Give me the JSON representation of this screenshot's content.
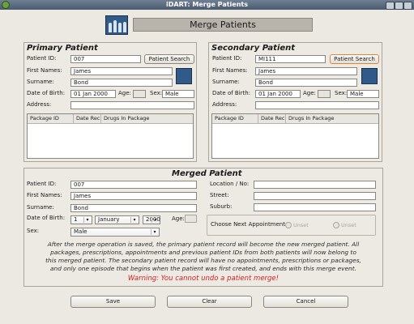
{
  "window": {
    "title": "iDART: Merge Patients"
  },
  "header": {
    "title": "Merge Patients"
  },
  "primary": {
    "title": "Primary Patient",
    "patient_id_label": "Patient ID:",
    "patient_id": "007",
    "search_button": "Patient Search",
    "first_names_label": "First Names:",
    "first_names": "James",
    "surname_label": "Surname:",
    "surname": "Bond",
    "dob_label": "Date of Birth:",
    "dob": "01 Jan 2000",
    "age_label": "Age:",
    "age": "",
    "sex_label": "Sex:",
    "sex": "Male",
    "address_label": "Address:",
    "address": "",
    "table_headers": [
      "Package ID",
      "Date Rec",
      "Drugs In Package"
    ]
  },
  "secondary": {
    "title": "Secondary Patient",
    "patient_id_label": "Patient ID:",
    "patient_id": "MI111",
    "search_button": "Patient Search",
    "first_names_label": "First Names:",
    "first_names": "James",
    "surname_label": "Surname:",
    "surname": "Bond",
    "dob_label": "Date of Birth:",
    "dob": "01 Jan 2000",
    "age_label": "Age:",
    "age": "",
    "sex_label": "Sex:",
    "sex": "Male",
    "address_label": "Address:",
    "address": "",
    "table_headers": [
      "Package ID",
      "Date Rec",
      "Drugs In Package"
    ]
  },
  "merged": {
    "title": "Merged Patient",
    "patient_id_label": "Patient ID:",
    "patient_id": "007",
    "first_names_label": "First Names:",
    "first_names": "James",
    "surname_label": "Surname:",
    "surname": "Bond",
    "dob_label": "Date of Birth:",
    "dob_day": "1",
    "dob_month": "January",
    "dob_year": "2000",
    "age_label": "Age:",
    "sex_label": "Sex:",
    "sex": "Male",
    "location_label": "Location / No:",
    "street_label": "Street:",
    "suburb_label": "Suburb:",
    "appointment_label": "Choose Next Appointment:",
    "appointment_options": [
      "Unset",
      "Unset"
    ]
  },
  "note": "After the merge operation is saved, the primary patient record will become the new merged patient. All packages, prescriptions, appointments and previous patient IDs from both patients will now belong to this merged patient. The secondary patient record will have no appointments, prescriptions or packages, and only one episode that begins when the patient was first created, and ends with this merge event.",
  "warning": "Warning: You cannot undo a patient merge!",
  "buttons": {
    "save": "Save",
    "clear": "Clear",
    "cancel": "Cancel"
  },
  "colors": {
    "warning": "#d41e1e",
    "titlebar": "#5a6b80",
    "focus_border": "#d9893d"
  }
}
